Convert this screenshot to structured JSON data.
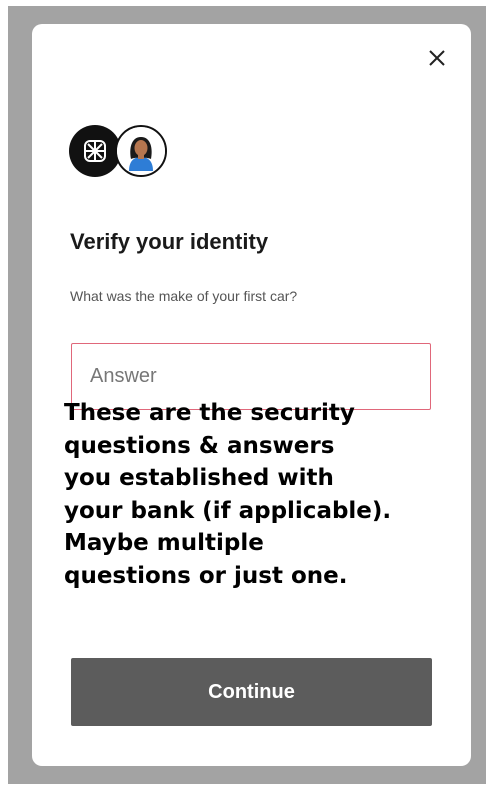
{
  "dialog": {
    "close_icon": "close-icon",
    "brand_logo_icon": "lattice-logo-icon",
    "user_avatar_icon": "user-avatar-icon",
    "title": "Verify your identity",
    "question": "What was the make of your first car?",
    "answer_placeholder": "Answer",
    "answer_value": "",
    "continue_label": "Continue",
    "colors": {
      "input_border": "#e0677a",
      "button_bg": "#5c5c5c",
      "backdrop": "#a3a3a3",
      "avatar_shirt": "#2e7dd6"
    }
  },
  "annotation": {
    "text": "These are the security\nquestions & answers\nyou established with\nyour bank (if applicable).\nMaybe multiple\nquestions or just one."
  }
}
